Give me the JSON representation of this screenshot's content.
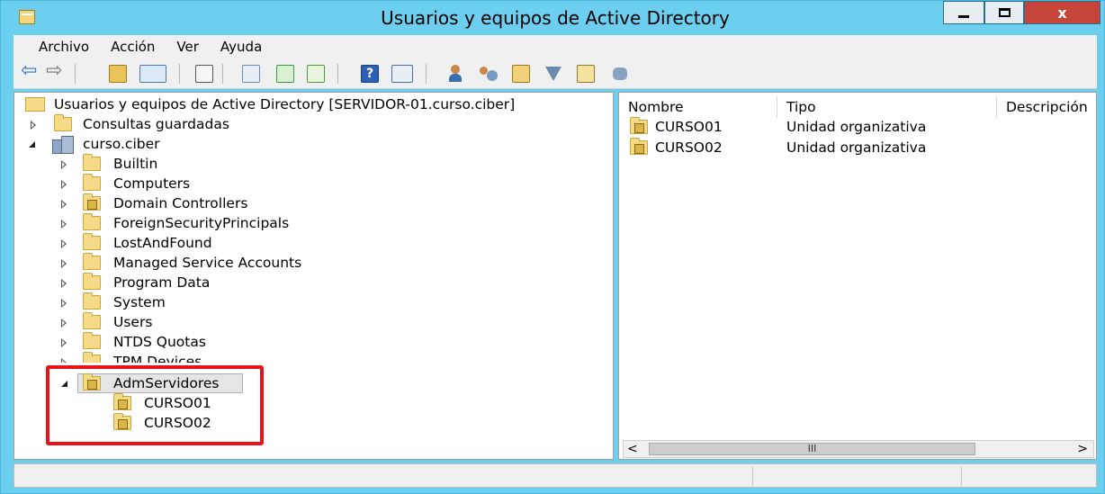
{
  "window": {
    "title": "Usuarios y equipos de Active Directory",
    "close_glyph": "x"
  },
  "menu": [
    "Archivo",
    "Acción",
    "Ver",
    "Ayuda"
  ],
  "toolbar_icons": [
    "back-arrow-icon",
    "forward-arrow-icon",
    "folder-up-icon",
    "show-tree-icon",
    "clipboard-icon",
    "properties-icon",
    "refresh-icon",
    "export-list-icon",
    "help-icon",
    "view-icon",
    "new-user-icon",
    "new-group-icon",
    "new-ou-icon",
    "filter-icon",
    "find-icon",
    "delegate-icon"
  ],
  "tree": {
    "root": "Usuarios y equipos de Active Directory [SERVIDOR-01.curso.ciber]",
    "saved_queries": "Consultas guardadas",
    "domain": "curso.ciber",
    "children": [
      "Builtin",
      "Computers",
      "Domain Controllers",
      "ForeignSecurityPrincipals",
      "LostAndFound",
      "Managed Service Accounts",
      "Program Data",
      "System",
      "Users",
      "NTDS Quotas",
      "TPM Devices"
    ],
    "selected": "AdmServidores",
    "selected_children": [
      "CURSO01",
      "CURSO02"
    ]
  },
  "list": {
    "columns": [
      "Nombre",
      "Tipo",
      "Descripción"
    ],
    "rows": [
      {
        "name": "CURSO01",
        "type": "Unidad organizativa"
      },
      {
        "name": "CURSO02",
        "type": "Unidad organizativa"
      }
    ],
    "scroll_thumb": "III",
    "scroll_left": "<",
    "scroll_right": ">"
  },
  "colors": {
    "titlebar": "#6ccff0",
    "close_button": "#c7443a",
    "highlight_box": "#e8121b"
  }
}
